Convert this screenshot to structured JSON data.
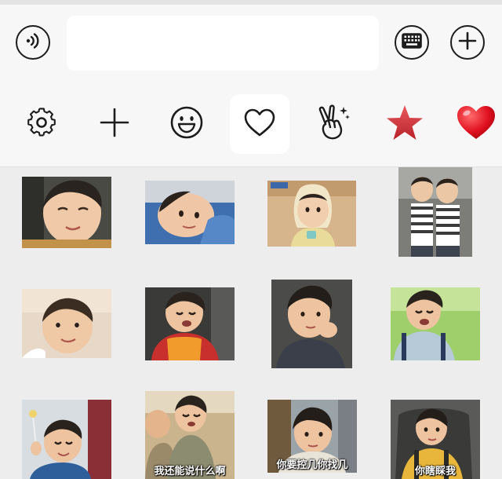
{
  "input_bar": {
    "voice_icon": "voice-icon",
    "text_value": "",
    "keyboard_icon": "keyboard-icon",
    "more_icon": "plus-circle-icon"
  },
  "tabs": [
    {
      "icon": "settings-icon",
      "active": false
    },
    {
      "icon": "add-icon",
      "active": false
    },
    {
      "icon": "emoji-icon",
      "active": false
    },
    {
      "icon": "heart-outline-icon",
      "active": true
    },
    {
      "icon": "victory-hand-icon",
      "active": false
    },
    {
      "icon": "star-icon",
      "active": false,
      "color": "#d8363c"
    },
    {
      "icon": "heart-icon",
      "active": false,
      "color": "#e0101f"
    }
  ],
  "stickers": [
    {
      "name": "baby-squint-smile-sticker",
      "caption": ""
    },
    {
      "name": "baby-lying-down-sticker",
      "caption": ""
    },
    {
      "name": "baby-yellow-hood-sticker",
      "caption": ""
    },
    {
      "name": "twins-striped-shirts-sticker",
      "caption": ""
    },
    {
      "name": "baby-smiling-close-up-sticker",
      "caption": ""
    },
    {
      "name": "baby-crying-orange-vest-sticker",
      "caption": ""
    },
    {
      "name": "baby-hand-on-cheek-sticker",
      "caption": ""
    },
    {
      "name": "baby-crying-blue-shirt-sticker",
      "caption": ""
    },
    {
      "name": "baby-lollipop-sticker",
      "caption": ""
    },
    {
      "name": "baby-with-monk-sticker",
      "caption": "我还能说什么啊"
    },
    {
      "name": "baby-bowl-cut-sticker",
      "caption": "你要控几你找几"
    },
    {
      "name": "baby-car-seat-sticker",
      "caption": "你瞎睬我"
    }
  ]
}
